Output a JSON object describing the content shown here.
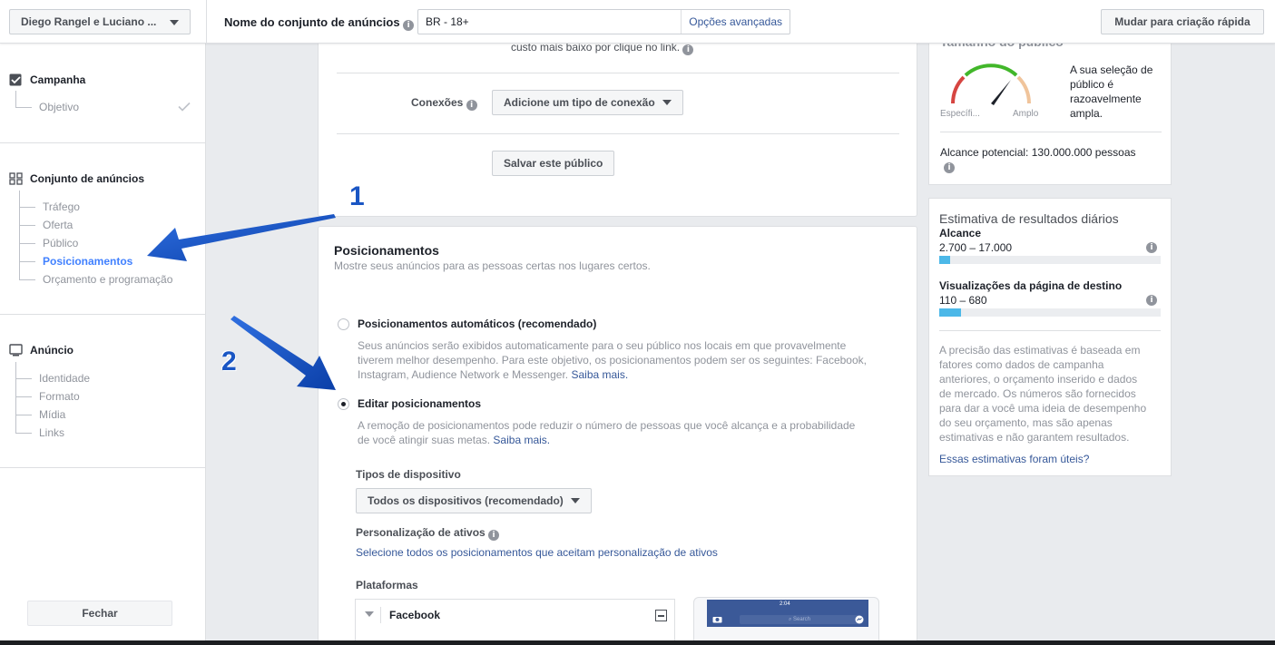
{
  "topbar": {
    "account": "Diego Rangel e Luciano ...",
    "adset_name_label": "Nome do conjunto de anúncios",
    "adset_name_value": "BR - 18+",
    "advanced_options": "Opções avançadas",
    "quick_create": "Mudar para criação rápida"
  },
  "sidebar": {
    "campaign": {
      "title": "Campanha",
      "items": [
        "Objetivo"
      ]
    },
    "adset": {
      "title": "Conjunto de anúncios",
      "items": [
        "Tráfego",
        "Oferta",
        "Público",
        "Posicionamentos",
        "Orçamento e programação"
      ]
    },
    "ad": {
      "title": "Anúncio",
      "items": [
        "Identidade",
        "Formato",
        "Mídia",
        "Links"
      ]
    },
    "close": "Fechar"
  },
  "audience": {
    "cut_text": "custo mais baixo por clique no link.",
    "connections_label": "Conexões",
    "connections_button": "Adicione um tipo de conexão",
    "save_button": "Salvar este público"
  },
  "placements": {
    "title": "Posicionamentos",
    "subtitle": "Mostre seus anúncios para as pessoas certas nos lugares certos.",
    "auto_label": "Posicionamentos automáticos (recomendado)",
    "auto_desc_1": "Seus anúncios serão exibidos automaticamente para o seu público nos locais em que provavelmente",
    "auto_desc_2": "tiverem melhor desempenho. Para este objetivo, os posicionamentos podem ser os seguintes: Facebook,",
    "auto_desc_3": "Instagram, Audience Network e Messenger.",
    "learn_more": "Saiba mais.",
    "edit_label": "Editar posicionamentos",
    "edit_desc_1": "A remoção de posicionamentos pode reduzir o número de pessoas que você alcança e a probabilidade",
    "edit_desc_2": "de você atingir suas metas.",
    "device_types_label": "Tipos de dispositivo",
    "device_types_value": "Todos os dispositivos (recomendado)",
    "asset_custom_label": "Personalização de ativos",
    "asset_custom_link": "Selecione todos os posicionamentos que aceitam personalização de ativos",
    "platforms_label": "Plataformas",
    "platform_facebook": "Facebook",
    "phone_time": "2:04",
    "phone_search": "Search"
  },
  "audience_size": {
    "title": "Tamanho do público",
    "specific": "Específi...",
    "broad": "Amplo",
    "desc_1": "A sua seleção de",
    "desc_2": "público é",
    "desc_3": "razoavelmente",
    "desc_4": "ampla.",
    "potential_reach": "Alcance potencial: 130.000.000 pessoas"
  },
  "daily_results": {
    "title": "Estimativa de resultados diários",
    "reach_label": "Alcance",
    "reach_value": "2.700 – 17.000",
    "reach_fill": 0.05,
    "lpv_label": "Visualizações da página de destino",
    "lpv_value": "110 – 680",
    "lpv_fill": 0.1,
    "note_lines": [
      "A precisão das estimativas é baseada em",
      "fatores como dados de campanha",
      "anteriores, o orçamento inserido e dados",
      "de mercado. Os números são fornecidos",
      "para dar a você uma ideia de desempenho",
      "do seu orçamento, mas são apenas",
      "estimativas e não garantem resultados."
    ],
    "feedback_link": "Essas estimativas foram úteis?"
  },
  "annotations": {
    "step1": "1",
    "step2": "2"
  },
  "colors": {
    "accent": "#4080ff",
    "link": "#365899",
    "arrow": "#1a56c4",
    "progress": "#4cb8e8"
  }
}
